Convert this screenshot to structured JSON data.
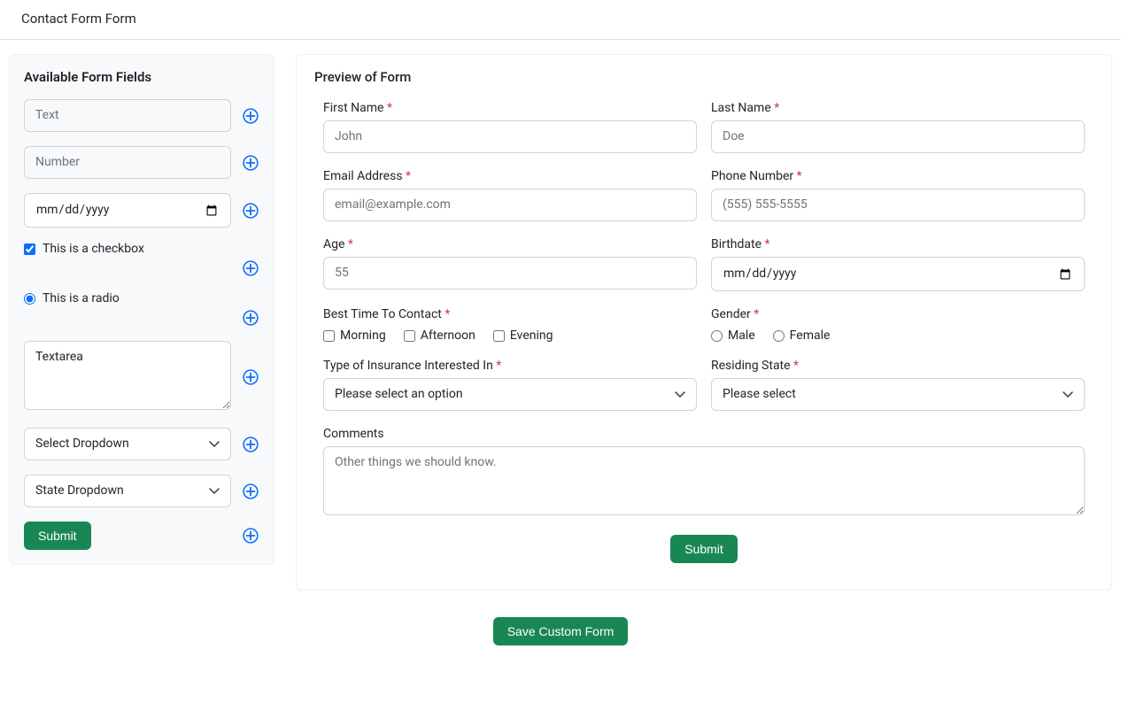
{
  "header": {
    "title": "Contact Form Form"
  },
  "sidebar": {
    "title": "Available Form Fields",
    "text_ph": "Text",
    "number_ph": "Number",
    "date_ph": "mm/dd/yyyy",
    "checkbox_label": "This is a checkbox",
    "radio_label": "This is a radio",
    "textarea_value": "Textarea",
    "select_option": "Select Dropdown",
    "state_option": "State Dropdown",
    "submit_label": "Submit"
  },
  "preview": {
    "title": "Preview of Form",
    "first_name": {
      "label": "First Name",
      "ph": "John"
    },
    "last_name": {
      "label": "Last Name",
      "ph": "Doe"
    },
    "email": {
      "label": "Email Address",
      "ph": "email@example.com"
    },
    "phone": {
      "label": "Phone Number",
      "ph": "(555) 555-5555"
    },
    "age": {
      "label": "Age",
      "ph": "55"
    },
    "birthdate": {
      "label": "Birthdate",
      "ph": "mm/dd/yyyy"
    },
    "best_time": {
      "label": "Best Time To Contact",
      "options": [
        "Morning",
        "Afternoon",
        "Evening"
      ]
    },
    "gender": {
      "label": "Gender",
      "options": [
        "Male",
        "Female"
      ]
    },
    "insurance": {
      "label": "Type of Insurance Interested In",
      "selected": "Please select an option"
    },
    "state": {
      "label": "Residing State",
      "selected": "Please select"
    },
    "comments": {
      "label": "Comments",
      "ph": "Other things we should know."
    },
    "submit_label": "Submit"
  },
  "save_label": "Save Custom Form"
}
